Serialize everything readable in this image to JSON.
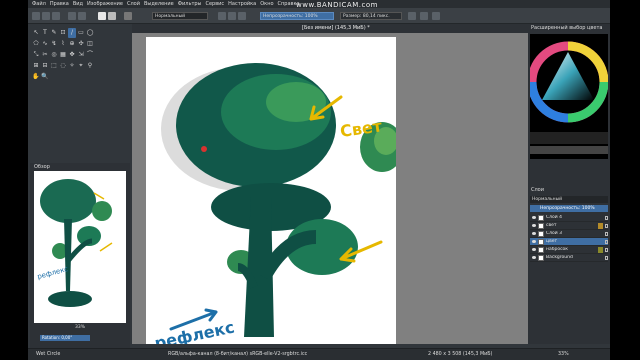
{
  "menubar": {
    "items": [
      "Файл",
      "Правка",
      "Вид",
      "Изображение",
      "Слой",
      "Выделение",
      "Фильтры",
      "Сервис",
      "Настройка",
      "Окно",
      "Справка"
    ]
  },
  "watermark": {
    "text": "www.BANDICAM.com"
  },
  "toolbar": {
    "blend_mode": "Нормальный",
    "opacity_label": "Непрозрачность: 100%",
    "size_label": "Размер: 80,14 пикс."
  },
  "tools": [
    "↖",
    "T",
    "✎",
    "⊡",
    "/",
    "▭",
    "◯",
    "⬠",
    "∿",
    "↯",
    "⌇",
    "⊕",
    "✣",
    "◫",
    "⤡",
    "✂",
    "◎",
    "▦",
    "✥",
    "⇲",
    "⌒",
    "⊞",
    "⊟",
    "⬚",
    "◌",
    "✧",
    "⌖",
    "⚲",
    "✋",
    "🔍"
  ],
  "overview": {
    "title": "Обзор",
    "zoom": "33%",
    "rotation": "Rotation: 0,00°"
  },
  "canvas": {
    "tab_title": "[Без имени]  (145,3 МиБ) *",
    "annotation_light": "Свет",
    "annotation_reflex": "рефлекс"
  },
  "right_panel": {
    "color_title": "Расширенный выбор цвета",
    "layers_title": "Слои",
    "layers_mode": "Нормальный",
    "layers_opacity": "Непрозрачность: 100%",
    "layers": [
      {
        "name": "Слой 4",
        "color": ""
      },
      {
        "name": "свет",
        "color": "#b38b2a"
      },
      {
        "name": "Слой 3",
        "color": ""
      },
      {
        "name": "цвет",
        "color": "#3f6ea3"
      },
      {
        "name": "набросок",
        "color": "#8a8a2a"
      },
      {
        "name": "Background",
        "color": ""
      }
    ]
  },
  "status": {
    "brush": "Wet Circle",
    "color_info": "RGB/альфа-канал (8-бит/канал)  sRGB-elle-V2-srgbtrc.icc",
    "image_size": "2 480 x 3 508 (145,3 МиБ)",
    "zoom": "33%"
  },
  "colors": {
    "app_bg": "#31363b",
    "accent": "#3f6ea3",
    "tree_dark": "#0f4f44",
    "tree_mid": "#1d7a56",
    "tree_light": "#4fa85a",
    "annotation_yellow": "#e6b800",
    "annotation_blue": "#1d6fa8"
  }
}
